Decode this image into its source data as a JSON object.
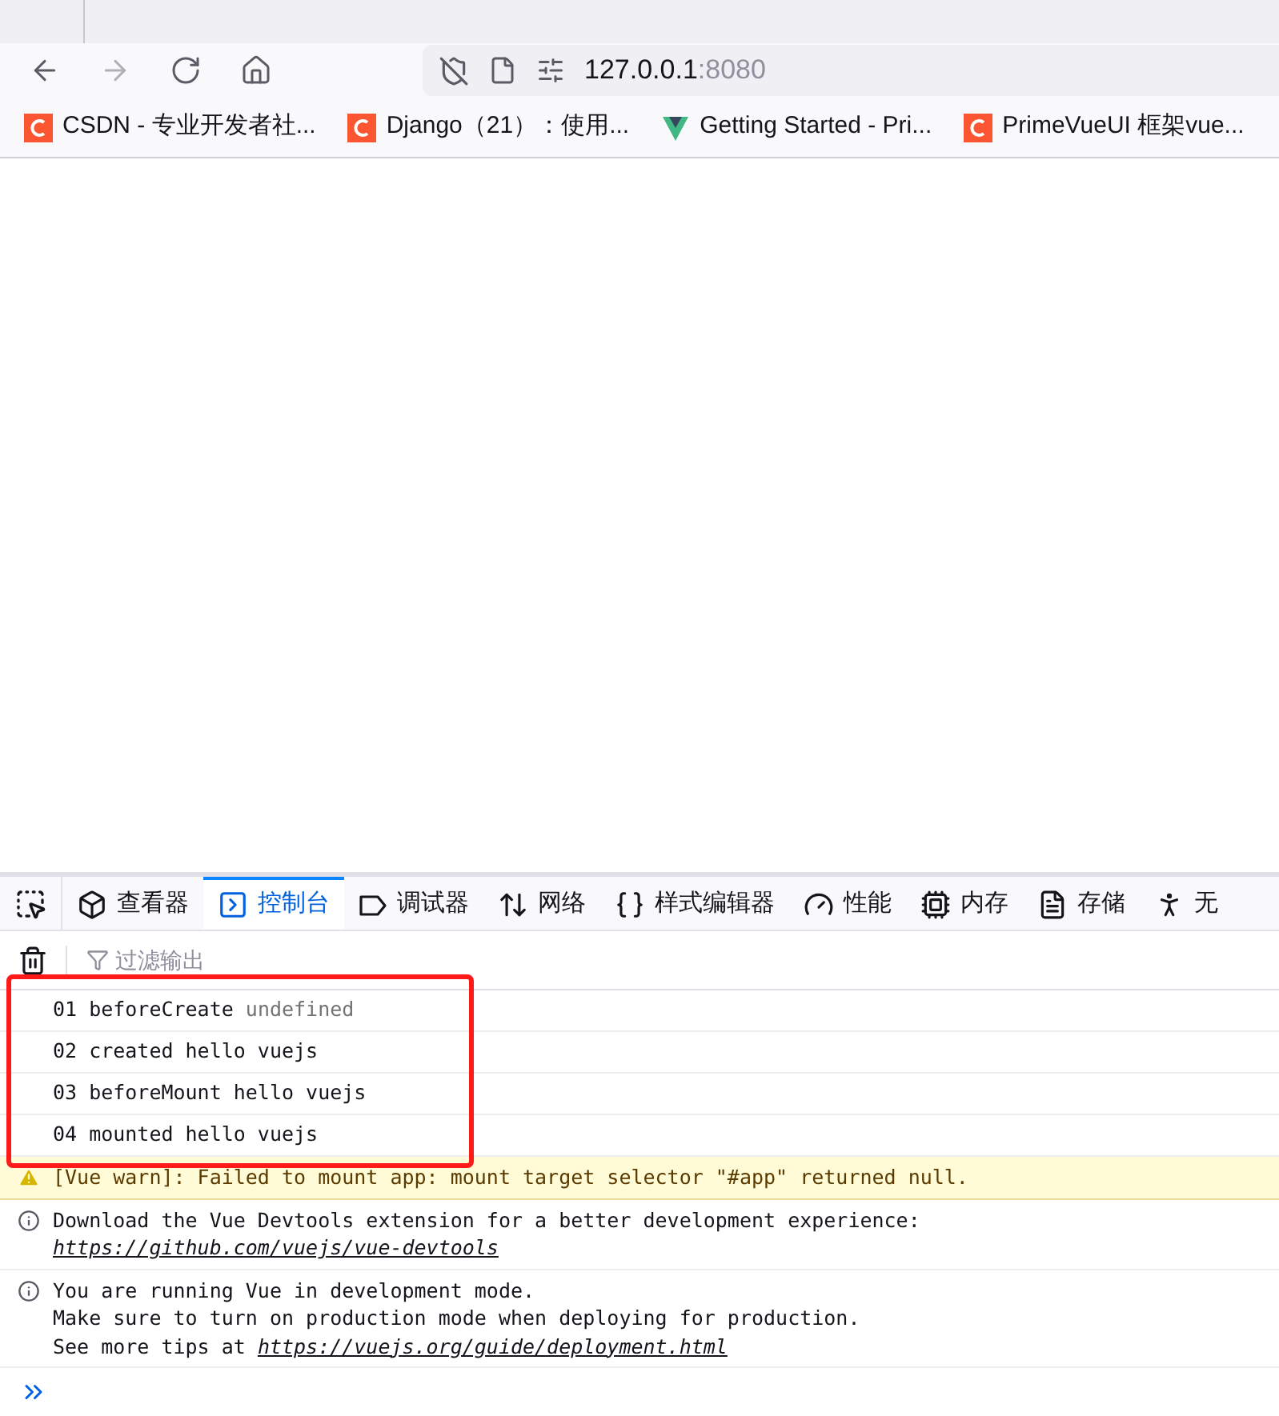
{
  "browser": {
    "nav": [
      {
        "kind": "back",
        "disabled": false
      },
      {
        "kind": "forward",
        "disabled": true
      },
      {
        "kind": "reload",
        "disabled": false
      },
      {
        "kind": "home",
        "disabled": false
      }
    ],
    "url": {
      "host": "127.0.0.1",
      "port": ":8080"
    },
    "bookmarks": [
      {
        "kind": "csdn",
        "label": "CSDN - 专业开发者社..."
      },
      {
        "kind": "csdn",
        "label": "Django（21）：使用..."
      },
      {
        "kind": "vue",
        "label": "Getting Started - Pri..."
      },
      {
        "kind": "csdn",
        "label": "PrimeVueUI 框架vue..."
      }
    ]
  },
  "devtools": {
    "tabs": [
      {
        "kind": "inspector",
        "label": "查看器",
        "selected": false
      },
      {
        "kind": "console",
        "label": "控制台",
        "selected": true
      },
      {
        "kind": "debugger",
        "label": "调试器",
        "selected": false
      },
      {
        "kind": "network",
        "label": "网络",
        "selected": false
      },
      {
        "kind": "style",
        "label": "样式编辑器",
        "selected": false
      },
      {
        "kind": "performance",
        "label": "性能",
        "selected": false
      },
      {
        "kind": "memory",
        "label": "内存",
        "selected": false
      },
      {
        "kind": "storage",
        "label": "存储",
        "selected": false
      },
      {
        "kind": "accessibility",
        "label": "无",
        "selected": false
      }
    ],
    "filter": {
      "placeholder": "过滤输出"
    },
    "highlighted_logs": [
      {
        "text": "01 beforeCreate",
        "value": "undefined"
      },
      {
        "text": "02 created hello vuejs"
      },
      {
        "text": "03 beforeMount hello vuejs"
      },
      {
        "text": "04 mounted hello vuejs"
      }
    ],
    "messages": [
      {
        "kind": "warn",
        "lines": [
          {
            "text": "[Vue warn]: Failed to mount app: mount target selector \"#app\" returned null."
          }
        ]
      },
      {
        "kind": "info",
        "lines": [
          {
            "text": "Download the Vue Devtools extension for a better development experience:"
          },
          {
            "link": "https://github.com/vuejs/vue-devtools"
          }
        ]
      },
      {
        "kind": "info",
        "lines": [
          {
            "text": "You are running Vue in development mode."
          },
          {
            "text": "Make sure to turn on production mode when deploying for production."
          },
          {
            "text": "See more tips at ",
            "link": "https://vuejs.org/guide/deployment.html"
          }
        ]
      }
    ]
  }
}
